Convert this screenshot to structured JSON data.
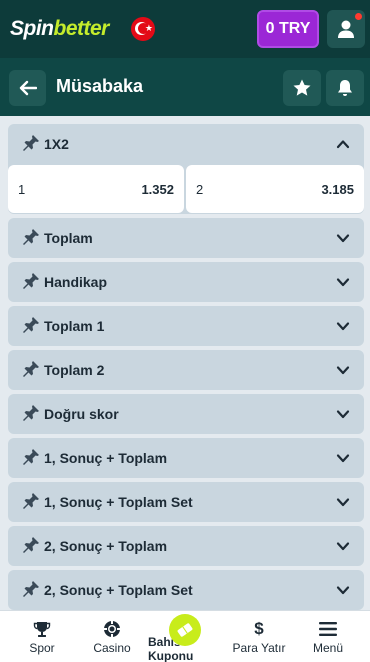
{
  "header": {
    "logo_part1": "Spin",
    "logo_part2": "better",
    "balance_label": "0 TRY"
  },
  "subheader": {
    "title": "Müsabaka"
  },
  "open_market": {
    "name": "1X2",
    "outcomes": [
      {
        "name": "1",
        "odd": "1.352"
      },
      {
        "name": "2",
        "odd": "3.185"
      }
    ]
  },
  "markets": [
    {
      "name": "Toplam"
    },
    {
      "name": "Handikap"
    },
    {
      "name": "Toplam 1"
    },
    {
      "name": "Toplam 2"
    },
    {
      "name": "Doğru skor"
    },
    {
      "name": "1, Sonuç + Toplam"
    },
    {
      "name": "1, Sonuç + Toplam Set"
    },
    {
      "name": "2, Sonuç + Toplam"
    },
    {
      "name": "2, Sonuç + Toplam Set"
    }
  ],
  "bottom_nav": {
    "items": [
      {
        "label": "Spor",
        "icon": "trophy-icon"
      },
      {
        "label": "Casino",
        "icon": "poker-chip-icon"
      },
      {
        "label": "Bahis Kuponu",
        "icon": "ticket-icon"
      },
      {
        "label": "Para Yatır",
        "icon": "dollar-icon"
      },
      {
        "label": "Menü",
        "icon": "menu-icon"
      }
    ]
  },
  "colors": {
    "header_bg": "#0d3b3a",
    "accent_lime": "#c8ec1b",
    "balance_purple": "#9b27d6",
    "market_bg": "#c9d6df"
  }
}
